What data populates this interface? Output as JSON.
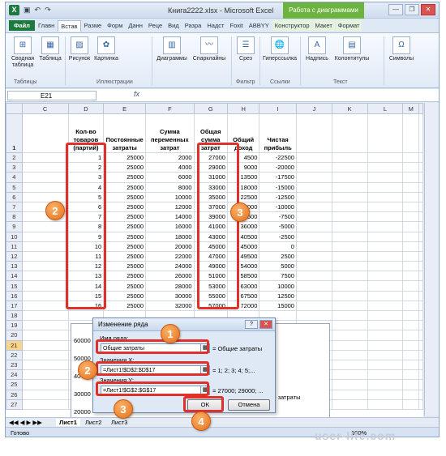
{
  "window": {
    "title": "Книга2222.xlsx - Microsoft Excel",
    "context_tab_group": "Работа с диаграммами",
    "controls": [
      "—",
      "❐",
      "✕"
    ]
  },
  "tabs": [
    "Файл",
    "Главн",
    "Встав",
    "Разме",
    "Форм",
    "Данн",
    "Реце",
    "Вид",
    "Разра",
    "Надст",
    "Foxit",
    "ABBYY",
    "Конструктор",
    "Макет",
    "Формат"
  ],
  "ribbon": {
    "buttons": [
      "Сводная таблица",
      "Таблица",
      "Рисунок",
      "Картинка",
      "Диаграммы",
      "Спарклайны",
      "Срез",
      "Гиперссылка",
      "Надпись",
      "Колонтитулы",
      "Символы"
    ],
    "groups": [
      "Таблицы",
      "Иллюстрации",
      "Фильтр",
      "Ссылки",
      "Текст"
    ]
  },
  "formula_bar": {
    "name_box": "E21",
    "fx": "fx",
    "content": ""
  },
  "sheet": {
    "columns": [
      "C",
      "D",
      "E",
      "F",
      "G",
      "H",
      "I",
      "J",
      "K",
      "L",
      "M"
    ],
    "header_row": [
      "",
      "Кол-во товаров (партий)",
      "Постоянные затраты",
      "Сумма переменных затрат",
      "Общая сумма затрат",
      "Общий доход",
      "Чистая прибыль",
      "",
      "",
      "",
      ""
    ],
    "rows": [
      [
        "2",
        "1",
        "25000",
        "2000",
        "27000",
        "4500",
        "-22500"
      ],
      [
        "3",
        "2",
        "25000",
        "4000",
        "29000",
        "9000",
        "-20000"
      ],
      [
        "4",
        "3",
        "25000",
        "6000",
        "31000",
        "13500",
        "-17500"
      ],
      [
        "5",
        "4",
        "25000",
        "8000",
        "33000",
        "18000",
        "-15000"
      ],
      [
        "6",
        "5",
        "25000",
        "10000",
        "35000",
        "22500",
        "-12500"
      ],
      [
        "7",
        "6",
        "25000",
        "12000",
        "37000",
        "27000",
        "-10000"
      ],
      [
        "8",
        "7",
        "25000",
        "14000",
        "39000",
        "31500",
        "-7500"
      ],
      [
        "9",
        "8",
        "25000",
        "16000",
        "41000",
        "36000",
        "-5000"
      ],
      [
        "10",
        "9",
        "25000",
        "18000",
        "43000",
        "40500",
        "-2500"
      ],
      [
        "11",
        "10",
        "25000",
        "20000",
        "45000",
        "45000",
        "0"
      ],
      [
        "12",
        "11",
        "25000",
        "22000",
        "47000",
        "49500",
        "2500"
      ],
      [
        "13",
        "12",
        "25000",
        "24000",
        "49000",
        "54000",
        "5000"
      ],
      [
        "14",
        "13",
        "25000",
        "26000",
        "51000",
        "58500",
        "7500"
      ],
      [
        "15",
        "14",
        "25000",
        "28000",
        "53000",
        "63000",
        "10000"
      ],
      [
        "16",
        "15",
        "25000",
        "30000",
        "55000",
        "67500",
        "12500"
      ],
      [
        "17",
        "16",
        "25000",
        "32000",
        "57000",
        "72000",
        "15000"
      ]
    ],
    "extra_rows": [
      "18",
      "19",
      "20",
      "21",
      "22",
      "23",
      "24",
      "25",
      "26",
      "27"
    ]
  },
  "chart": {
    "y_ticks": [
      "60000",
      "50000",
      "40",
      "30000",
      "20000"
    ],
    "legend_text": "щие затраты"
  },
  "dialog": {
    "title": "Изменение ряда",
    "help": "?",
    "close": "✕",
    "name_label": "Имя ряда:",
    "name_value": "Общие затраты",
    "name_preview": "= Общие затраты",
    "x_label": "Значения X:",
    "x_value": "=Лист1!$D$2:$D$17",
    "x_preview": "= 1; 2; 3; 4; 5;...",
    "y_label": "Значения Y:",
    "y_value": "=Лист1!$G$2:$G$17",
    "y_preview": "= 27000; 29000; ...",
    "ok": "OK",
    "cancel": "Отмена"
  },
  "sheet_tabs": [
    "Лист1",
    "Лист2",
    "Лист3"
  ],
  "status": {
    "ready": "Готово",
    "zoom": "100%"
  },
  "badges": [
    "1",
    "2",
    "3",
    "4"
  ],
  "watermark": "user-life.com",
  "colors": {
    "highlight": "#e0302a",
    "badge": "#e56f1c",
    "excel_green": "#1d7a3e",
    "selected_cell": "#f9d48a"
  }
}
